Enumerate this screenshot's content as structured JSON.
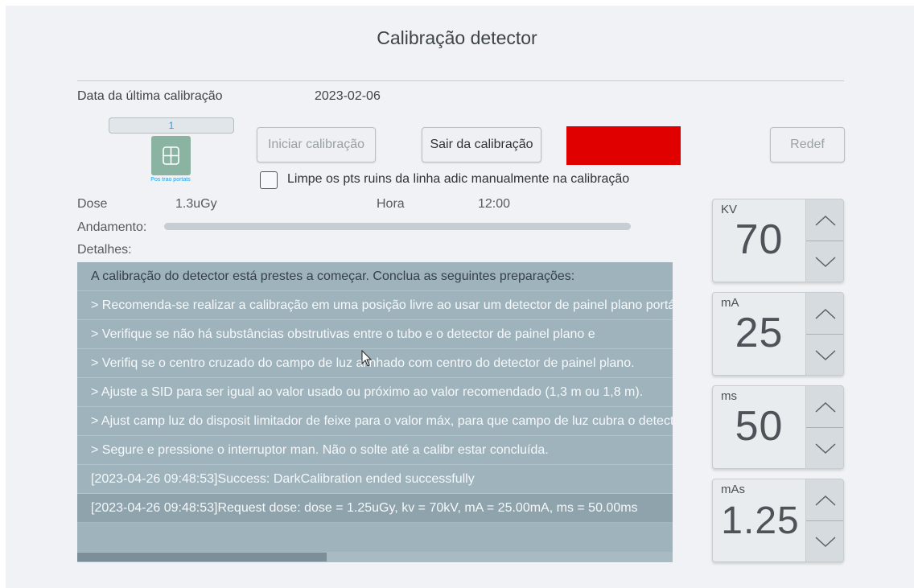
{
  "window": {
    "title": "Calibração detector"
  },
  "calibration": {
    "last_label": "Data da última calibração",
    "last_date": "2023-02-06",
    "dose_label": "Dose",
    "dose_value": "1.3uGy",
    "time_label": "Hora",
    "time_value": "12:00",
    "progress_label": "Andamento:",
    "progress": 0,
    "details_label": "Detalhes:"
  },
  "position": {
    "number": "1",
    "caption": "Pos trao portats",
    "icon": "detector-grid-icon"
  },
  "buttons": {
    "start": "Iniciar calibração",
    "exit": "Sair da calibração",
    "reset": "Redef"
  },
  "status_indicator": {
    "color": "#e00000"
  },
  "checkbox": {
    "label": "Limpe os pts ruins da linha adic manualmente na calibração",
    "checked": false
  },
  "details": [
    "A calibração do detector está prestes a começar. Conclua as seguintes preparações:",
    "> Recomenda-se realizar a calibração em uma posição livre ao usar um detector de painel plano portátil.",
    "> Verifique se não há substâncias obstrutivas entre o tubo e o detector de painel plano e",
    "> Verifiq se o centro cruzado do campo de luz alinhado com centro do detector de painel plano.",
    "> Ajuste a SID para ser igual ao valor usado ou próximo ao valor recomendado (1,3 m ou 1,8 m).",
    "> Ajust camp luz do disposit limitador de feixe para o valor máx, para que campo de luz cubra o detector.",
    "> Segure e pressione o interruptor man. Não o solte até a calibr estar concluída.",
    "[2023-04-26 09:48:53]Success: DarkCalibration ended successfully",
    "[2023-04-26 09:48:53]Request dose: dose = 1.25uGy, kv = 70kV, mA = 25.00mA, ms = 50.00ms"
  ],
  "selected_detail_index": 8,
  "params": [
    {
      "name": "KV",
      "value": "70"
    },
    {
      "name": "mA",
      "value": "25"
    },
    {
      "name": "ms",
      "value": "50"
    },
    {
      "name": "mAs",
      "value": "1.25"
    }
  ],
  "colors": {
    "background": "#f0f2f5",
    "details_bg": "#9eb3bb",
    "position_icon": "#8bb3a2",
    "accent_blue": "#1aa0e8"
  }
}
